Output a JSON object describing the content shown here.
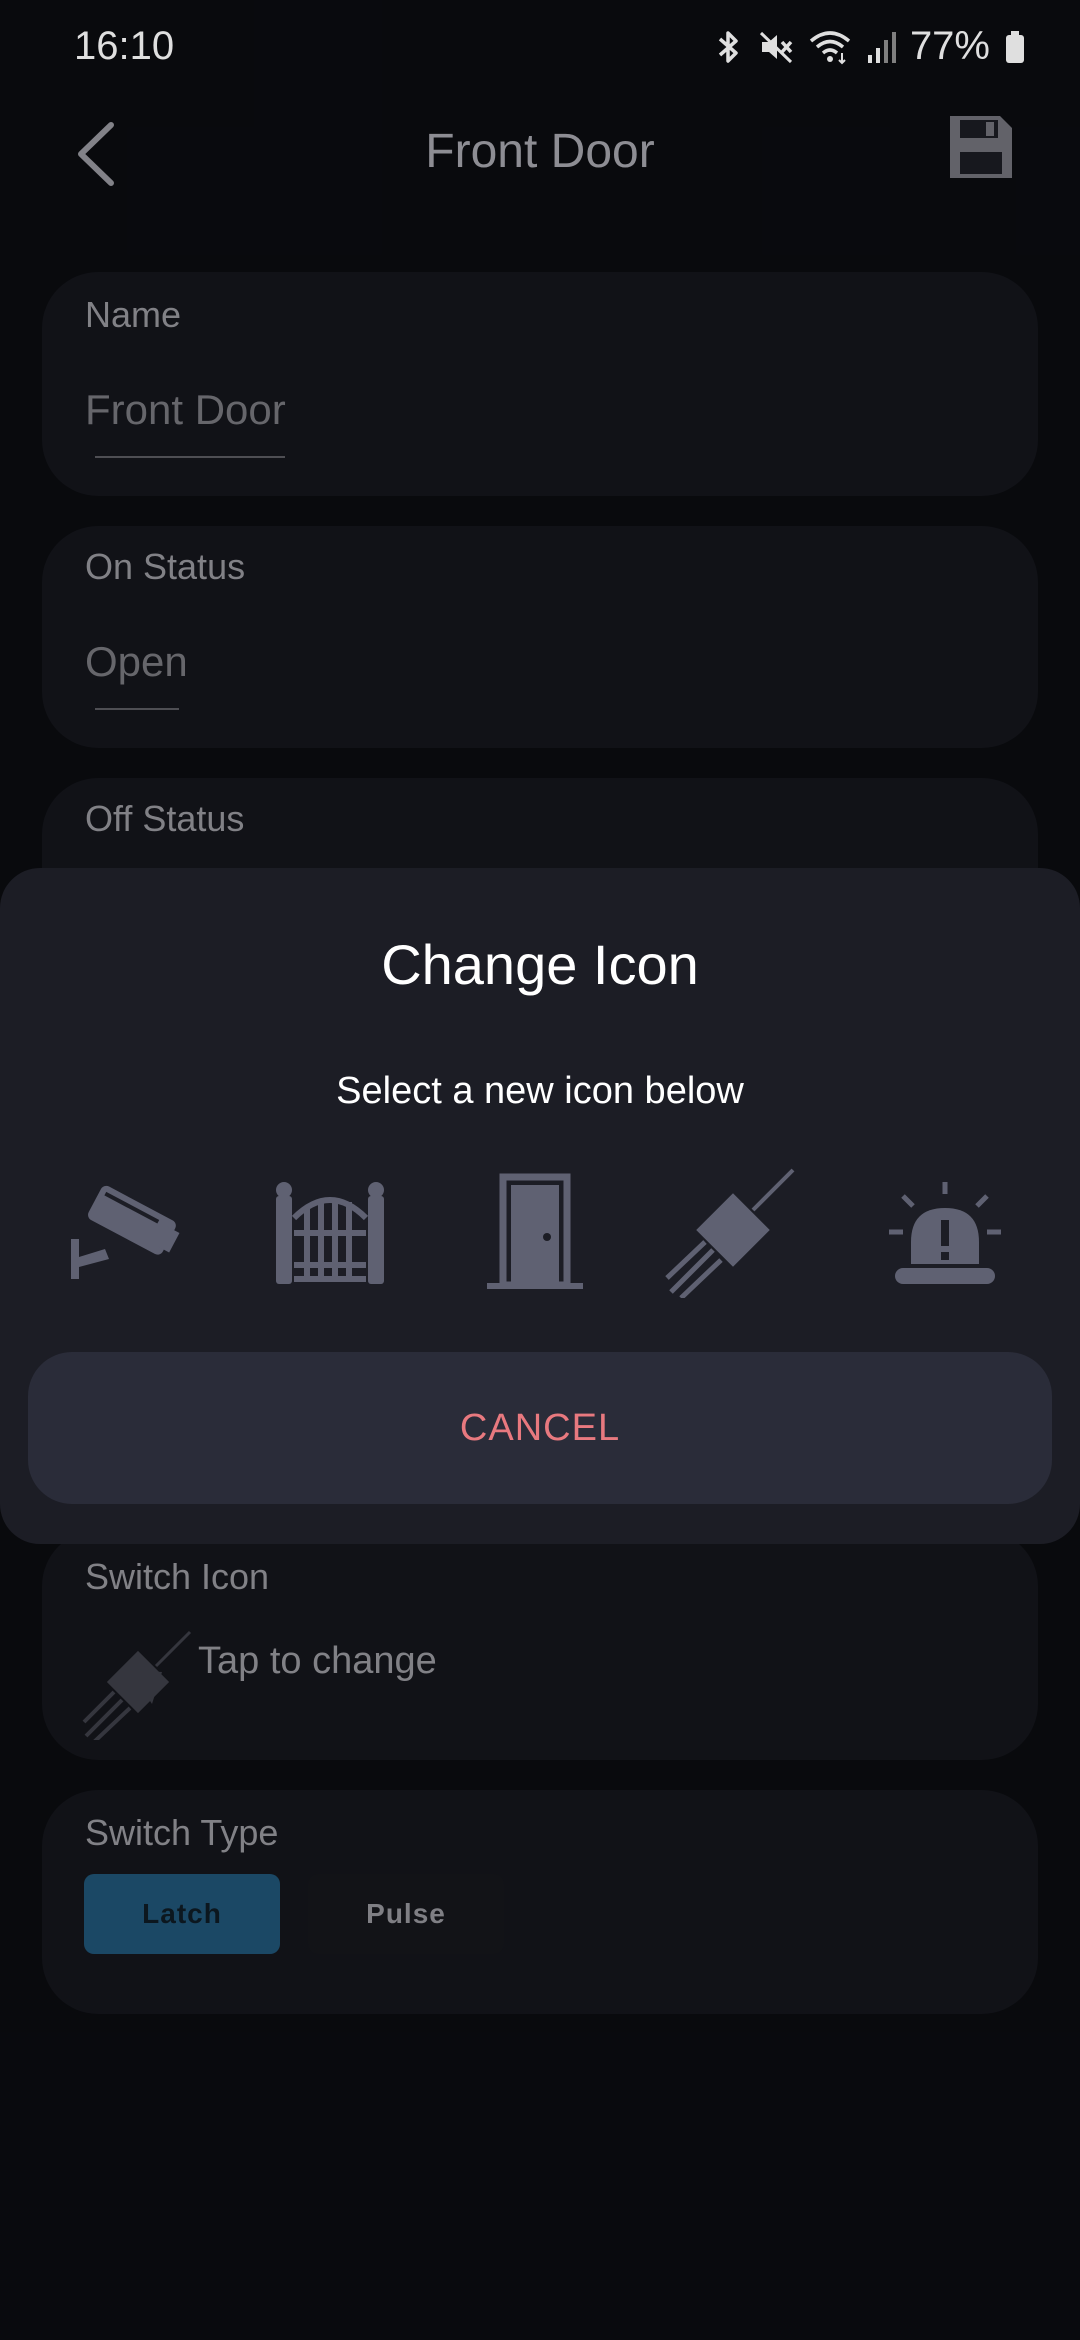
{
  "status_bar": {
    "time": "16:10",
    "battery": "77%",
    "icons": [
      "bluetooth-icon",
      "mute-icon",
      "wifi-icon",
      "signal-icon",
      "battery-icon"
    ]
  },
  "header": {
    "title": "Front Door",
    "back_icon": "chevron-left-icon",
    "save_icon": "floppy-disk-icon"
  },
  "form": {
    "name": {
      "label": "Name",
      "value": "Front Door"
    },
    "on_status": {
      "label": "On Status",
      "value": "Open"
    },
    "off_status": {
      "label": "Off Status"
    },
    "switch_icon": {
      "label": "Switch Icon",
      "hint": "Tap to change",
      "icon": "plug-icon"
    },
    "switch_type": {
      "label": "Switch Type",
      "options": [
        "Latch",
        "Pulse"
      ],
      "selected": "Latch"
    }
  },
  "dialog": {
    "title": "Change Icon",
    "subtitle": "Select a new icon below",
    "icons": [
      "security-camera-icon",
      "gate-icon",
      "door-icon",
      "plug-icon",
      "alarm-light-icon"
    ],
    "cancel_label": "CANCEL"
  },
  "colors": {
    "background": "#0a0b0f",
    "card": "#131419",
    "dialog": "#1c1d25",
    "cancel_button": "#2a2c39",
    "cancel_text": "#e8797f",
    "icon": "#5f6172",
    "selected_segment": "#1e4f6e"
  }
}
